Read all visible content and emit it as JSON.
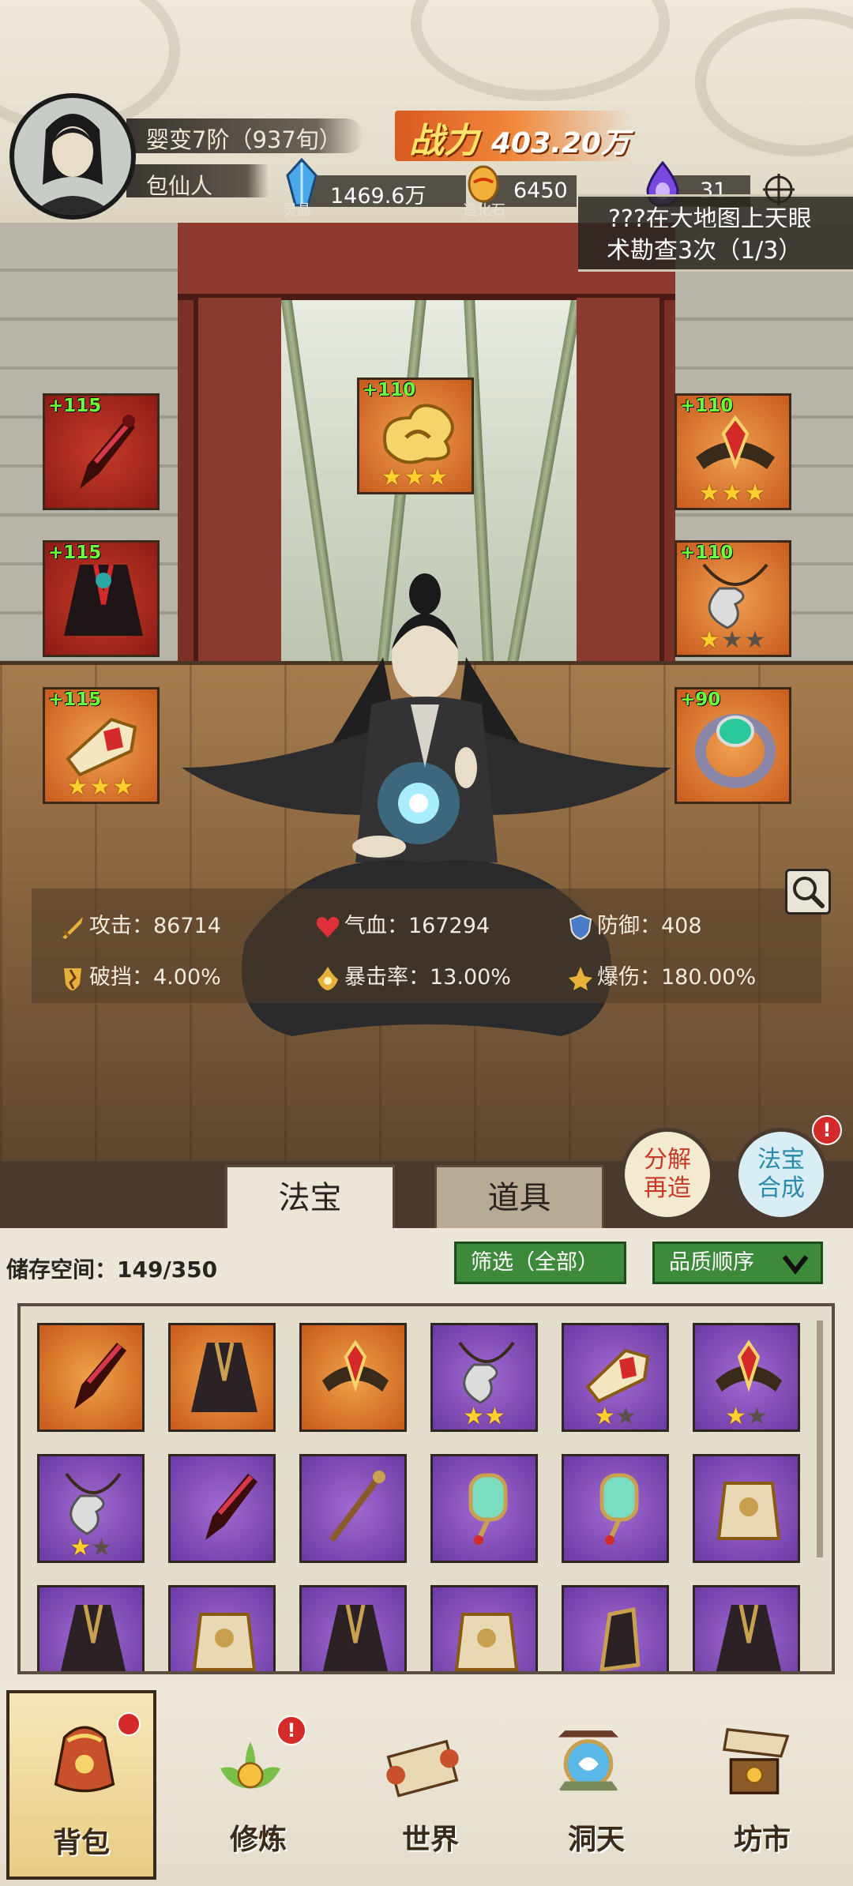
{
  "player": {
    "realm": "婴变7阶（937旬）",
    "name": "包仙人",
    "power_label": "战力",
    "power_value": "403.20万"
  },
  "resources": [
    {
      "value": "1469.6万",
      "label": "灵晶",
      "icon": "blue-crystal-icon",
      "color": "#4aa8e8"
    },
    {
      "value": "6450",
      "label": "造化石",
      "icon": "golden-egg-icon",
      "color": "#f0b03a"
    },
    {
      "value": "31",
      "label": "",
      "icon": "purple-flame-icon",
      "color": "#7a4ae0"
    }
  ],
  "quest": {
    "line1": "???在大地图上天眼",
    "line2": "术勘查3次（1/3）"
  },
  "equipped": [
    {
      "level": "+115",
      "stars": 0,
      "max": 0,
      "rarity": "red",
      "item": "dagger-icon"
    },
    {
      "level": "+110",
      "stars": 3,
      "max": 3,
      "rarity": "orange",
      "item": "golden-cloud-icon"
    },
    {
      "level": "+110",
      "stars": 3,
      "max": 3,
      "rarity": "orange",
      "item": "crown-icon"
    },
    {
      "level": "+115",
      "stars": 0,
      "max": 0,
      "rarity": "red",
      "item": "robe-icon"
    },
    {
      "level": "+110",
      "stars": 1,
      "max": 3,
      "rarity": "orange",
      "item": "pendant-icon"
    },
    {
      "level": "+115",
      "stars": 3,
      "max": 3,
      "rarity": "orange",
      "item": "boots-icon"
    },
    {
      "level": "+90",
      "stars": 0,
      "max": 0,
      "rarity": "orange",
      "item": "ring-icon"
    }
  ],
  "stats": [
    {
      "label": "攻击：",
      "value": "86714",
      "icon": "sword-icon"
    },
    {
      "label": "气血：",
      "value": "167294",
      "icon": "heart-icon"
    },
    {
      "label": "防御：",
      "value": "408",
      "icon": "shield-icon"
    },
    {
      "label": "破挡：",
      "value": "4.00%",
      "icon": "break-icon"
    },
    {
      "label": "暴击率：",
      "value": "13.00%",
      "icon": "crit-icon"
    },
    {
      "label": "爆伤：",
      "value": "180.00%",
      "icon": "crit-damage-icon"
    }
  ],
  "tabs": {
    "fabao": "法宝",
    "daoju": "道具"
  },
  "actions": {
    "decompose": "分解再造",
    "decompose_l1": "分解",
    "decompose_l2": "再造",
    "fuse_l1": "法宝",
    "fuse_l2": "合成",
    "fuse_badge": "!"
  },
  "inventory": {
    "storage_label": "储存空间：",
    "storage_value": "149/350",
    "filter_label": "筛选（全部）",
    "sort_label": "品质顺序",
    "items": [
      {
        "rarity": "orange",
        "stars": 0,
        "max": 0,
        "item": "dagger-icon"
      },
      {
        "rarity": "orange",
        "stars": 0,
        "max": 0,
        "item": "robe-icon"
      },
      {
        "rarity": "orange",
        "stars": 0,
        "max": 0,
        "item": "crown-icon"
      },
      {
        "rarity": "purple",
        "stars": 2,
        "max": 2,
        "item": "pendant-icon"
      },
      {
        "rarity": "purple",
        "stars": 1,
        "max": 2,
        "item": "boots-icon"
      },
      {
        "rarity": "purple",
        "stars": 1,
        "max": 2,
        "item": "crown-icon"
      },
      {
        "rarity": "purple",
        "stars": 1,
        "max": 2,
        "item": "pendant-icon"
      },
      {
        "rarity": "purple",
        "stars": 0,
        "max": 0,
        "item": "dagger-icon"
      },
      {
        "rarity": "purple",
        "stars": 0,
        "max": 0,
        "item": "staff-icon"
      },
      {
        "rarity": "purple",
        "stars": 0,
        "max": 0,
        "item": "mirror-icon"
      },
      {
        "rarity": "purple",
        "stars": 0,
        "max": 0,
        "item": "mirror-icon"
      },
      {
        "rarity": "purple",
        "stars": 0,
        "max": 0,
        "item": "armor-icon"
      },
      {
        "rarity": "purple",
        "stars": 0,
        "max": 0,
        "item": "robe-icon"
      },
      {
        "rarity": "purple",
        "stars": 0,
        "max": 0,
        "item": "armor-icon"
      },
      {
        "rarity": "purple",
        "stars": 0,
        "max": 0,
        "item": "robe-icon"
      },
      {
        "rarity": "purple",
        "stars": 0,
        "max": 0,
        "item": "armor-icon"
      },
      {
        "rarity": "purple",
        "stars": 0,
        "max": 0,
        "item": "gauntlet-icon"
      },
      {
        "rarity": "purple",
        "stars": 0,
        "max": 0,
        "item": "robe-icon"
      }
    ]
  },
  "nav": [
    {
      "label": "背包",
      "icon": "bag-icon",
      "badge": "",
      "active": true
    },
    {
      "label": "修炼",
      "icon": "lotus-icon",
      "badge": "!",
      "active": false
    },
    {
      "label": "世界",
      "icon": "scroll-icon",
      "badge": "",
      "active": false
    },
    {
      "label": "洞天",
      "icon": "portal-icon",
      "badge": "",
      "active": false
    },
    {
      "label": "坊市",
      "icon": "market-icon",
      "badge": "",
      "active": false
    }
  ],
  "colors": {
    "equip_level": "#6dff3a",
    "power": "#ffe36a",
    "rarity_orange": "#e0812e",
    "rarity_red": "#b02a1e",
    "rarity_purple": "#8a52c2",
    "filter_green": "#3d8a3a"
  }
}
